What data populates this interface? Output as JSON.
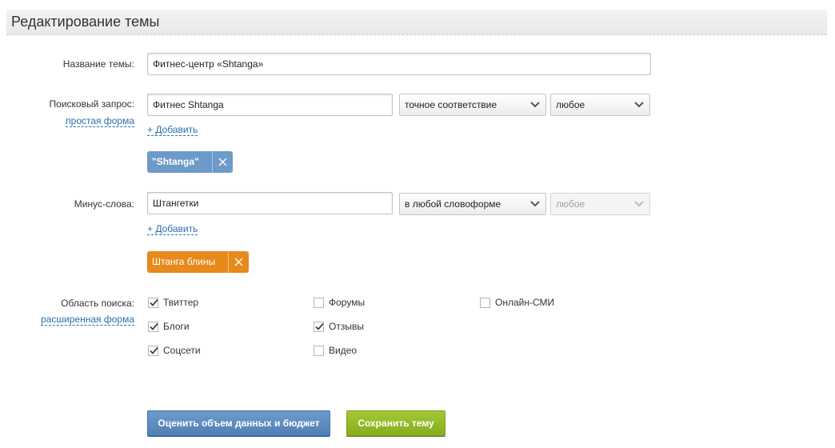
{
  "header": {
    "title": "Редактирование темы"
  },
  "topic_name": {
    "label": "Название темы:",
    "value": "Фитнес-центр «Shtanga»"
  },
  "search_query": {
    "label": "Поисковый запрос:",
    "form_link": "простая форма",
    "value": "Фитнес Shtanga",
    "match_select": "точное соответствие",
    "any_select": "любое",
    "add_link": "+ Добавить",
    "tag": "\"Shtanga\""
  },
  "minus_words": {
    "label": "Минус-слова:",
    "value": "Штангетки",
    "form_select": "в любой словоформе",
    "any_select": "любое",
    "add_link": "+ Добавить",
    "tag": "Штанга блины"
  },
  "search_area": {
    "label": "Область поиска:",
    "form_link": "расширенная форма",
    "options": [
      {
        "label": "Твиттер",
        "checked": true
      },
      {
        "label": "Форумы",
        "checked": false
      },
      {
        "label": "Онлайн-СМИ",
        "checked": false
      },
      {
        "label": "Блоги",
        "checked": true
      },
      {
        "label": "Отзывы",
        "checked": true
      },
      {
        "label": "Соцсети",
        "checked": true
      },
      {
        "label": "Видео",
        "checked": false
      }
    ]
  },
  "actions": {
    "estimate_label": "Оценить объем данных и бюджет",
    "save_label": "Сохранить тему"
  },
  "colors": {
    "tag_blue": "#6d9ac9",
    "tag_orange": "#e8891c",
    "button_blue": "#5b8bc1",
    "button_green": "#93b928",
    "link": "#2a6fb0"
  }
}
